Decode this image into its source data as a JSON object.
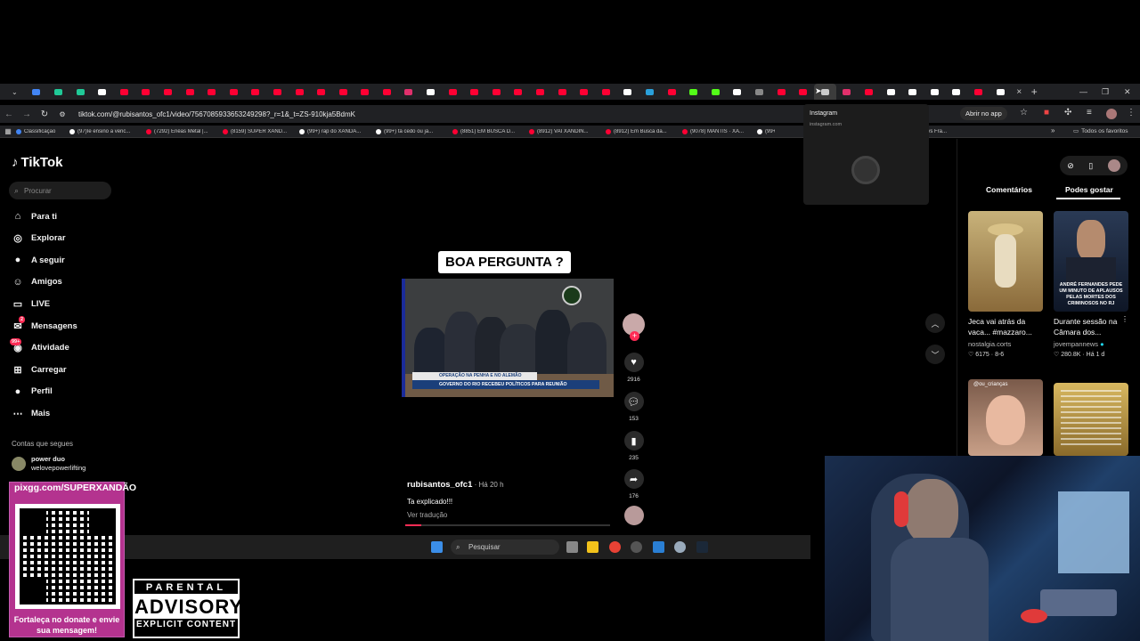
{
  "browser": {
    "url": "tiktok.com/@rubisantos_ofc1/video/7567085933653249298?_r=1&_t=ZS-910kja5BdmK",
    "open_in_app": "Abrir no app",
    "tab_close": "×",
    "new_tab": "+",
    "tab_icon_colors": [
      "#4285f4",
      "#20c997",
      "#20c997",
      "#ffffff",
      "#ff0033",
      "#ff0033",
      "#ff0033",
      "#ff0033",
      "#ff0033",
      "#ff0033",
      "#ff0033",
      "#ff0033",
      "#ff0033",
      "#ff0033",
      "#ff0033",
      "#ff0033",
      "#ff0033",
      "#e1306c",
      "#ffffff",
      "#ff0033",
      "#ff0033",
      "#ff0033",
      "#ff0033",
      "#ff0033",
      "#ff0033",
      "#ff0033",
      "#ff0033",
      "#ffffff",
      "#2aa0da",
      "#ff0033",
      "#53fc18",
      "#53fc18",
      "#ffffff",
      "#888888",
      "#ff0033",
      "#ff0033",
      "#cccccc",
      "#e1306c",
      "#ff0033",
      "#ffffff",
      "#ffffff",
      "#ffffff",
      "#ffffff",
      "#ff0033",
      "#ffffff"
    ],
    "bookmarks": [
      {
        "label": "Classificação",
        "color": "#4285f4"
      },
      {
        "label": "(97)Ie ensino a venc...",
        "color": "#ffffff"
      },
      {
        "label": "(7292) Enéas Metal |...",
        "color": "#ff0033"
      },
      {
        "label": "(8159) SUPER XAND...",
        "color": "#ff0033"
      },
      {
        "label": "(99+) rap do XANDÃ...",
        "color": "#ffffff"
      },
      {
        "label": "(99+) tá cedo ou já...",
        "color": "#ffffff"
      },
      {
        "label": "(8851) EM BUSCA D...",
        "color": "#ff0033"
      },
      {
        "label": "(8912) VAI XANDIN...",
        "color": "#ff0033"
      },
      {
        "label": "(8912) Em Busca da...",
        "color": "#ff0033"
      },
      {
        "label": "(9078) MANTIS · XA...",
        "color": "#ff0033"
      },
      {
        "label": "(99+) O",
        "color": "#ffffff"
      },
      {
        "label": "Xandão vs Fra...",
        "color": "#ff0033"
      }
    ],
    "all_favorites": "Todos os favoritos"
  },
  "hover_popup": {
    "title": "Instagram",
    "url": "instagram.com"
  },
  "tiktok": {
    "logo": "TikTok",
    "search_placeholder": "Procurar",
    "nav": [
      {
        "label": "Para ti",
        "icon": "home-icon"
      },
      {
        "label": "Explorar",
        "icon": "compass-icon"
      },
      {
        "label": "A seguir",
        "icon": "following-icon"
      },
      {
        "label": "Amigos",
        "icon": "friends-icon"
      },
      {
        "label": "LIVE",
        "icon": "live-icon"
      },
      {
        "label": "Mensagens",
        "icon": "messages-icon",
        "badge": "2"
      },
      {
        "label": "Atividade",
        "icon": "activity-icon",
        "badge": "99+"
      },
      {
        "label": "Carregar",
        "icon": "upload-icon"
      },
      {
        "label": "Perfil",
        "icon": "profile-icon"
      },
      {
        "label": "Mais",
        "icon": "more-icon"
      }
    ],
    "following_title": "Contas que segues",
    "followed_account": {
      "name": "power duo",
      "handle": "welovepowerlifting"
    },
    "video": {
      "overlay_caption": "BOA PERGUNTA ?",
      "lower_third": "GOVERNO DO RIO RECEBEU POLÍTICOS PARA REUNIÃO",
      "lower_third_top": "OPERAÇÃO NA PENHA E NO ALEMÃO",
      "username": "rubisantos_ofc1",
      "time": " · Há 20 h",
      "description": "Ta explicado!!!",
      "translate": "Ver tradução",
      "progress": 0.08
    },
    "actions": {
      "likes": "2916",
      "comments": "153",
      "saves": "235",
      "shares": "176"
    },
    "right_panel": {
      "tab_comments": "Comentários",
      "tab_likes": "Podes gostar",
      "items": [
        {
          "title": "Jeca vai atrás da vaca... #mazzaro...",
          "author": "nostalgia.corts",
          "likes": "6175",
          "date": "8-6"
        },
        {
          "title": "Durante sessão na Câmara dos...",
          "author": "jovempannews",
          "likes": "280.8K",
          "date": "Há 1 d",
          "thumb_text": "ANDRÉ FERNANDES PEDE UM MINUTO DE APLAUSOS PELAS MORTES DOS CRIMINOSOS NO RJ"
        },
        {
          "title": "",
          "author": "",
          "thumb_text": "@ou_crianças"
        },
        {
          "title": "",
          "author": ""
        }
      ]
    }
  },
  "taskbar": {
    "search": "Pesquisar"
  },
  "overlay": {
    "donate_url": "pixgg.com/SUPERXANDÃO",
    "donate_msg": "Fortaleça no donate e envie sua mensagem!",
    "advisory_line1": "PARENTAL",
    "advisory_line2": "ADVISORY",
    "advisory_line3": "EXPLICIT CONTENT"
  }
}
